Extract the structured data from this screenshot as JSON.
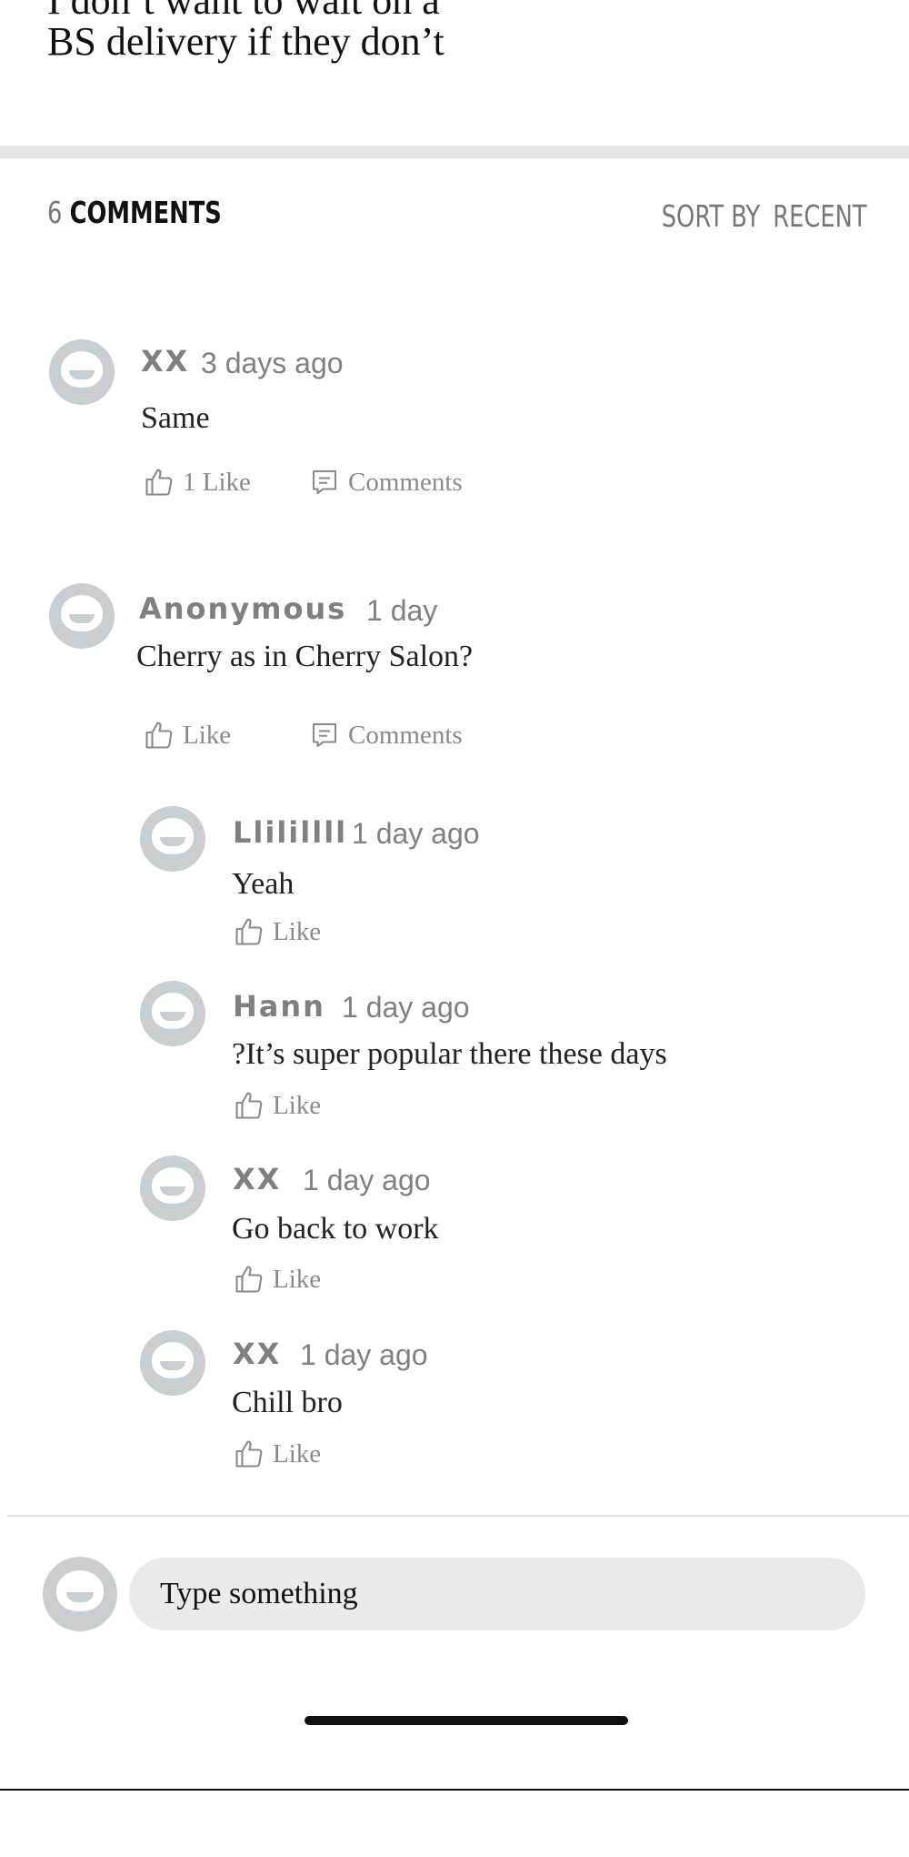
{
  "post": {
    "text_line1": "I don’t want to wait on a",
    "text_line2": "BS delivery if they don’t"
  },
  "comments_header": {
    "count": "6",
    "label": "COMMENTS",
    "sort_label": "SORT BY",
    "sort_value": "RECENT"
  },
  "comments": [
    {
      "author": "XX",
      "time": "3 days ago",
      "text": "Same",
      "like_label": "1 Like",
      "comments_label": "Comments"
    },
    {
      "author": "Anonymous",
      "time": "1 day",
      "text": "Cherry as in Cherry Salon?",
      "like_label": "Like",
      "comments_label": "Comments"
    }
  ],
  "replies": [
    {
      "author": "Llilillll",
      "time": "1 day ago",
      "text": "Yeah",
      "like_label": "Like"
    },
    {
      "author": "Hann",
      "time": "1 day ago",
      "text": "?It’s super popular there these days",
      "like_label": "Like"
    },
    {
      "author": "XX",
      "time": "1 day ago",
      "text": "Go back to work",
      "like_label": "Like"
    },
    {
      "author": "XX",
      "time": "1 day ago",
      "text": "Chill bro",
      "like_label": "Like"
    }
  ],
  "input": {
    "placeholder": "Type something"
  },
  "icons": {
    "like": "thumbs-up-icon",
    "comment": "comment-icon",
    "avatar": "default-avatar-icon"
  }
}
